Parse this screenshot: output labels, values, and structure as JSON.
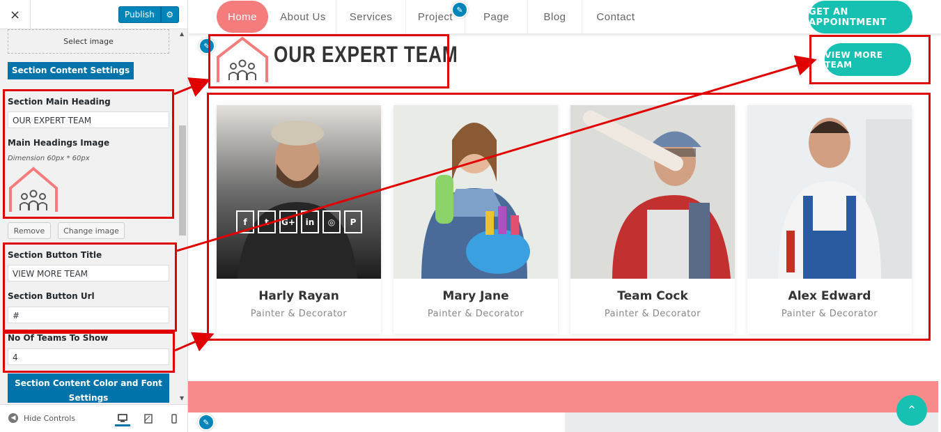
{
  "sidebar": {
    "close_icon": "×",
    "publish_label": "Publish",
    "gear_icon": "⚙",
    "select_image_label": "Select image",
    "section_content_settings": "Section Content Settings",
    "main_heading_label": "Section Main Heading",
    "main_heading_value": "OUR EXPERT TEAM",
    "headings_image_label": "Main Headings Image",
    "dimension_desc": "Dimension 60px * 60px",
    "remove_label": "Remove",
    "change_image_label": "Change image",
    "button_title_label": "Section Button Title",
    "button_title_value": "VIEW MORE TEAM",
    "button_url_label": "Section Button Url",
    "button_url_value": "#",
    "teams_count_label": "No Of Teams To Show",
    "teams_count_value": "4",
    "color_font_settings": "Section Content Color and Font Settings",
    "hide_controls_label": "Hide Controls",
    "hide_controls_icon": "◀",
    "device_icons": [
      "desktop-icon",
      "tablet-icon",
      "mobile-icon"
    ]
  },
  "preview": {
    "nav": [
      "Home",
      "About Us",
      "Services",
      "Project",
      "Page",
      "Blog",
      "Contact"
    ],
    "appointment_button": "GET AN APPOINTMENT",
    "section_heading": "OUR EXPERT TEAM",
    "view_more_button": "VIEW MORE TEAM",
    "team": [
      {
        "name": "Harly Rayan",
        "role": "Painter & Decorator"
      },
      {
        "name": "Mary Jane",
        "role": "Painter & Decorator"
      },
      {
        "name": "Team Cock",
        "role": "Painter & Decorator"
      },
      {
        "name": "Alex Edward",
        "role": "Painter & Decorator"
      }
    ],
    "social_icons": [
      "f",
      "t",
      "G+",
      "in",
      "◎",
      "P"
    ],
    "scroll_top_icon": "⌃"
  },
  "colors": {
    "accent_pink": "#f57c7c",
    "accent_teal": "#17c1b2",
    "wp_blue": "#0073aa",
    "annotation_red": "#e00000"
  }
}
